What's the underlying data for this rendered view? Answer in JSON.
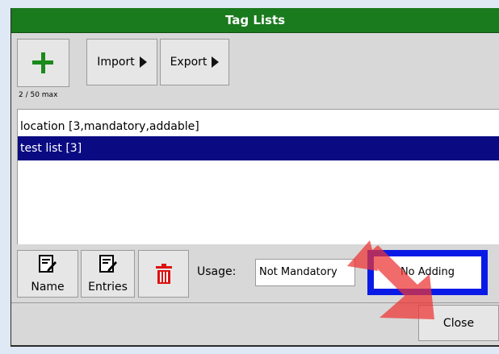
{
  "window": {
    "title": "Tag Lists"
  },
  "toolbar": {
    "add_icon": "plus-icon",
    "import_label": "Import",
    "export_label": "Export",
    "count_label": "2 / 50 max"
  },
  "tag_lists": [
    {
      "label": "location [3,mandatory,addable]",
      "selected": false
    },
    {
      "label": "test list [3]",
      "selected": true
    }
  ],
  "actions": {
    "name_label": "Name",
    "entries_label": "Entries",
    "delete_icon": "trash-icon",
    "usage_label": "Usage:",
    "mandatory_value": "Not Mandatory",
    "adding_value": "No Adding"
  },
  "footer": {
    "close_label": "Close"
  },
  "colors": {
    "title_bar": "#1a7a1e",
    "selection": "#0a0a82",
    "adding_border": "#0a1ae6",
    "plus_icon": "#1b8a1b",
    "trash_icon": "#dd1111",
    "hint_arrow": "#ee3333"
  }
}
